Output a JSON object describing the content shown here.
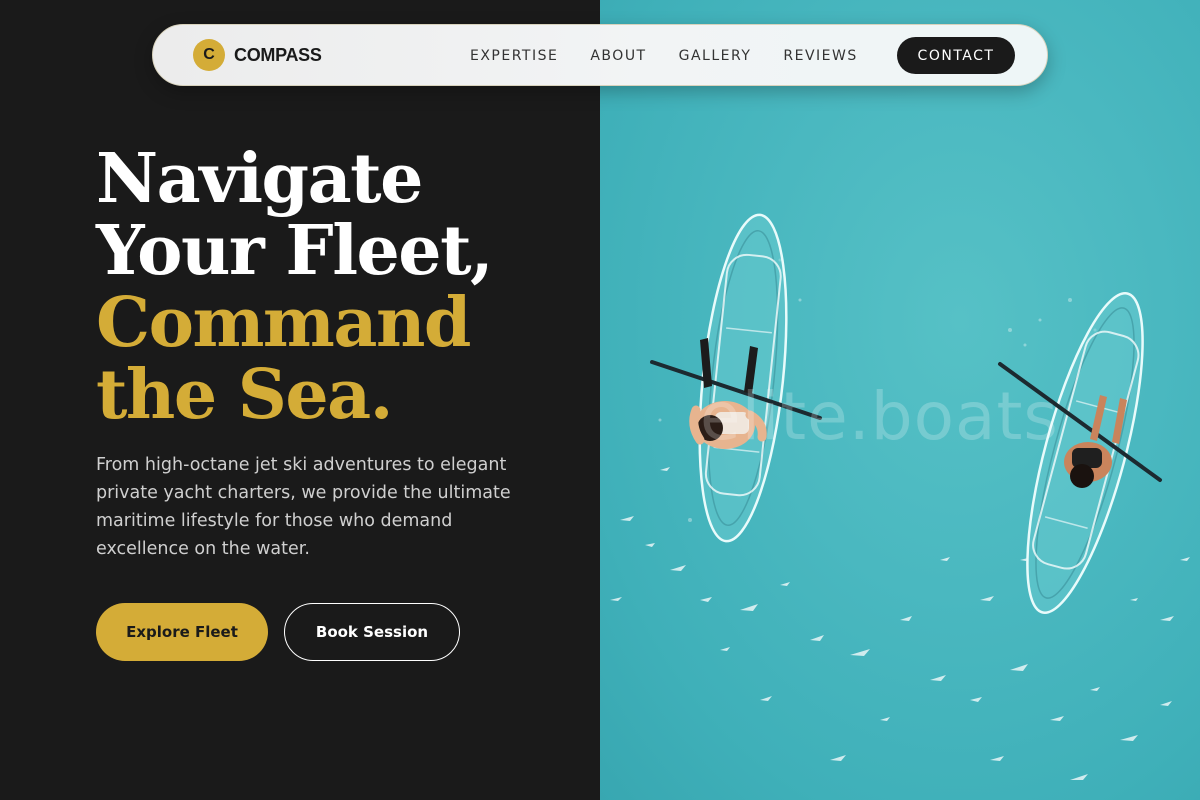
{
  "nav": {
    "brand_initial": "C",
    "brand_name": "COMPASS",
    "links": [
      "EXPERTISE",
      "ABOUT",
      "GALLERY",
      "REVIEWS"
    ],
    "contact_label": "CONTACT"
  },
  "hero": {
    "title_lines": [
      "Navigate",
      "Your Fleet,"
    ],
    "accent_lines": [
      "Command",
      "the Sea."
    ],
    "description": "From high-octane jet ski adventures to elegant private yacht charters, we provide the ultimate maritime lifestyle for those who demand excellence on the water.",
    "primary_cta": "Explore Fleet",
    "secondary_cta": "Book Session"
  },
  "image": {
    "watermark": "elite.boats",
    "subject": "aerial-two-clear-kayaks"
  },
  "colors": {
    "background": "#1a1a1a",
    "accent_gold": "#d4ac37",
    "water": "#4ab8c0",
    "white": "#ffffff"
  }
}
